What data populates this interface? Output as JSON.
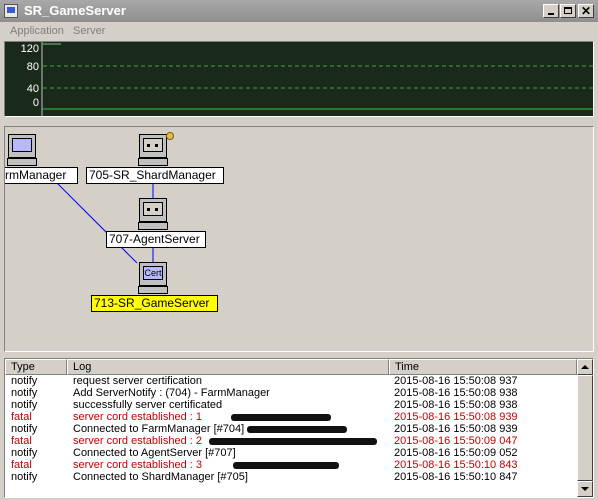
{
  "window": {
    "title": "SR_GameServer",
    "controls": {
      "minimize": "",
      "maximize": "",
      "close": "✕"
    }
  },
  "menu": [
    "Application",
    "Server"
  ],
  "graph": {
    "y_ticks": [
      "120",
      "80",
      "40",
      "0"
    ],
    "background": "#1a2a1a",
    "line_color": "#40c040"
  },
  "topology": {
    "nodes": [
      {
        "label": "rmManager",
        "icon": "computer-icon"
      },
      {
        "label": "705-SR_ShardManager",
        "icon": "computer-icon"
      },
      {
        "label": "707-AgentServer",
        "icon": "computer-icon"
      },
      {
        "label": "713-SR_GameServer",
        "icon": "certificate-computer-icon",
        "screen_text": "Cert",
        "highlighted": true
      }
    ],
    "link_color": "#0000ff"
  },
  "log": {
    "columns": [
      "Type",
      "Log",
      "Time"
    ],
    "rows": [
      {
        "type": "notify",
        "log": "request server certification",
        "time": "2015-08-16 15:50:08 937"
      },
      {
        "type": "notify",
        "log": "Add ServerNotify : (704) - FarmManager",
        "time": "2015-08-16 15:50:08 938"
      },
      {
        "type": "notify",
        "log": "successfully server certificated",
        "time": "2015-08-16 15:50:08 938"
      },
      {
        "type": "fatal",
        "log": "server cord established : 1",
        "time": "2015-08-16 15:50:08 939"
      },
      {
        "type": "notify",
        "log": "Connected to FarmManager [#704]",
        "time": "2015-08-16 15:50:08 939"
      },
      {
        "type": "fatal",
        "log": "server cord established : 2",
        "time": "2015-08-16 15:50:09 047"
      },
      {
        "type": "notify",
        "log": "Connected to AgentServer [#707]",
        "time": "2015-08-16 15:50:09 052"
      },
      {
        "type": "fatal",
        "log": "server cord established : 3",
        "time": "2015-08-16 15:50:10 843"
      },
      {
        "type": "notify",
        "log": "Connected to ShardManager [#705]",
        "time": "2015-08-16 15:50:10 847"
      }
    ],
    "fatal_color": "#c00000"
  }
}
